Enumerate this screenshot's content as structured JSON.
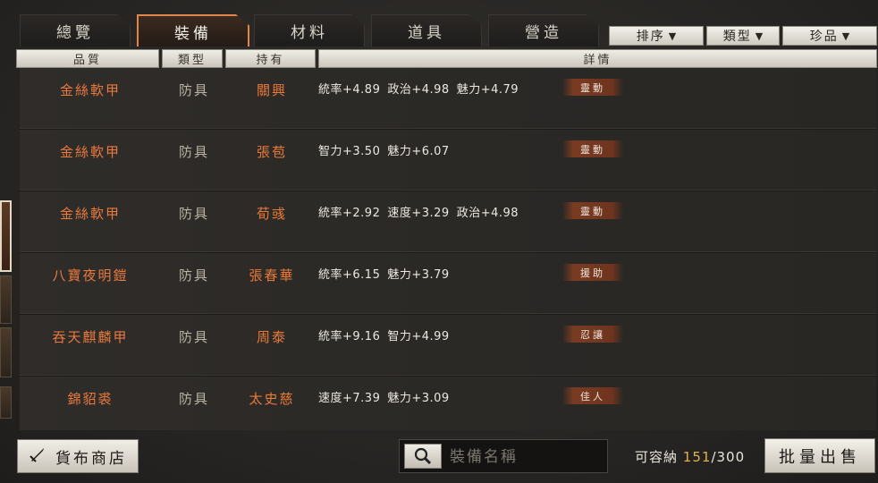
{
  "tabs": [
    {
      "label": "總覽",
      "active": false
    },
    {
      "label": "裝備",
      "active": true
    },
    {
      "label": "材料",
      "active": false
    },
    {
      "label": "道具",
      "active": false
    },
    {
      "label": "營造",
      "active": false
    }
  ],
  "sort_buttons": [
    {
      "label": "排序"
    },
    {
      "label": "類型"
    },
    {
      "label": "珍品"
    }
  ],
  "columns": {
    "quality": "品質",
    "type": "類型",
    "owner": "持有",
    "detail": "詳情"
  },
  "items": [
    {
      "name": "金絲軟甲",
      "type": "防具",
      "owner": "關興",
      "stats": [
        "統率+4.89",
        "政治+4.98",
        "魅力+4.79"
      ],
      "skill": "靈動"
    },
    {
      "name": "金絲軟甲",
      "type": "防具",
      "owner": "張苞",
      "stats": [
        "智力+3.50",
        "魅力+6.07"
      ],
      "skill": "靈動"
    },
    {
      "name": "金絲軟甲",
      "type": "防具",
      "owner": "荀彧",
      "stats": [
        "統率+2.92",
        "速度+3.29",
        "政治+4.98"
      ],
      "skill": "靈動"
    },
    {
      "name": "八寶夜明鎧",
      "type": "防具",
      "owner": "張春華",
      "stats": [
        "統率+6.15",
        "魅力+3.79"
      ],
      "skill": "援助"
    },
    {
      "name": "吞天麒麟甲",
      "type": "防具",
      "owner": "周泰",
      "stats": [
        "統率+9.16",
        "智力+4.99"
      ],
      "skill": "忍讓"
    },
    {
      "name": "錦貂裘",
      "type": "防具",
      "owner": "太史慈",
      "stats": [
        "速度+7.39",
        "魅力+3.09"
      ],
      "skill": "佳人"
    }
  ],
  "bottom": {
    "shop_label": "貨布商店",
    "search_placeholder": "裝備名稱",
    "capacity_label": "可容納",
    "capacity_current": "151",
    "capacity_max": "/300",
    "sell_label": "批量出售"
  },
  "colors": {
    "accent_orange": "#e8793f",
    "active_tab_border": "#e0864a",
    "capacity_highlight": "#e0b44a",
    "skill_badge": "#7a3b22"
  },
  "icons": {
    "shop": "sword-icon",
    "search": "magnifier-icon",
    "dropdown": "triangle-down-icon"
  }
}
